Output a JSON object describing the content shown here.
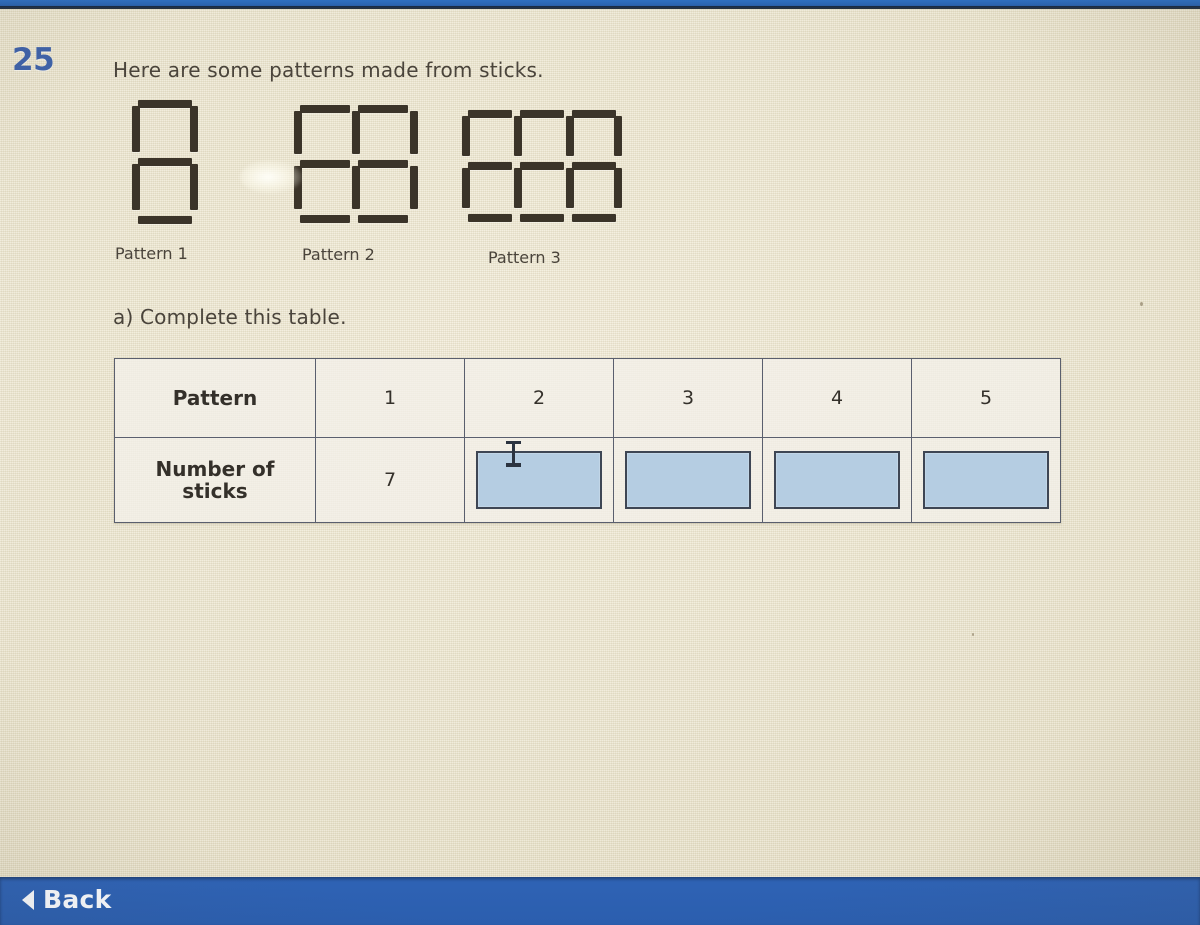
{
  "question": {
    "number": "25",
    "prompt": "Here are some patterns made from sticks.",
    "sub_question": "a) Complete this table."
  },
  "figures": [
    {
      "label": "Pattern 1",
      "columns": 1,
      "rows": 2,
      "sticks": 7
    },
    {
      "label": "Pattern 2",
      "columns": 2,
      "rows": 2,
      "sticks": 12
    },
    {
      "label": "Pattern 3",
      "columns": 3,
      "rows": 2,
      "sticks": 17
    }
  ],
  "table": {
    "row_headers": [
      "Pattern",
      "Number of\nsticks"
    ],
    "row1_label": "Pattern",
    "row2_label_line1": "Number of",
    "row2_label_line2": "sticks",
    "pattern_numbers": [
      "1",
      "2",
      "3",
      "4",
      "5"
    ],
    "stick_counts": [
      "7",
      "",
      "",
      "",
      ""
    ],
    "input_placeholders": [
      "",
      "",
      "",
      ""
    ]
  },
  "footer": {
    "back_label": "Back",
    "back_icon": "triangle-left-icon"
  },
  "colors": {
    "page_background": "#ece6d0",
    "accent_blue": "#2b5eae",
    "question_number": "#3f62a8",
    "stick": "#3b3429",
    "input_fill": "#b5cde2",
    "input_border": "#3e4654",
    "table_border": "#5a5f6e",
    "text": "#4a443b"
  },
  "chart_data": {
    "type": "table",
    "title": "Number of sticks per pattern",
    "categories": [
      "1",
      "2",
      "3",
      "4",
      "5"
    ],
    "values": [
      7,
      null,
      null,
      null,
      null
    ],
    "xlabel": "Pattern",
    "ylabel": "Number of sticks"
  }
}
